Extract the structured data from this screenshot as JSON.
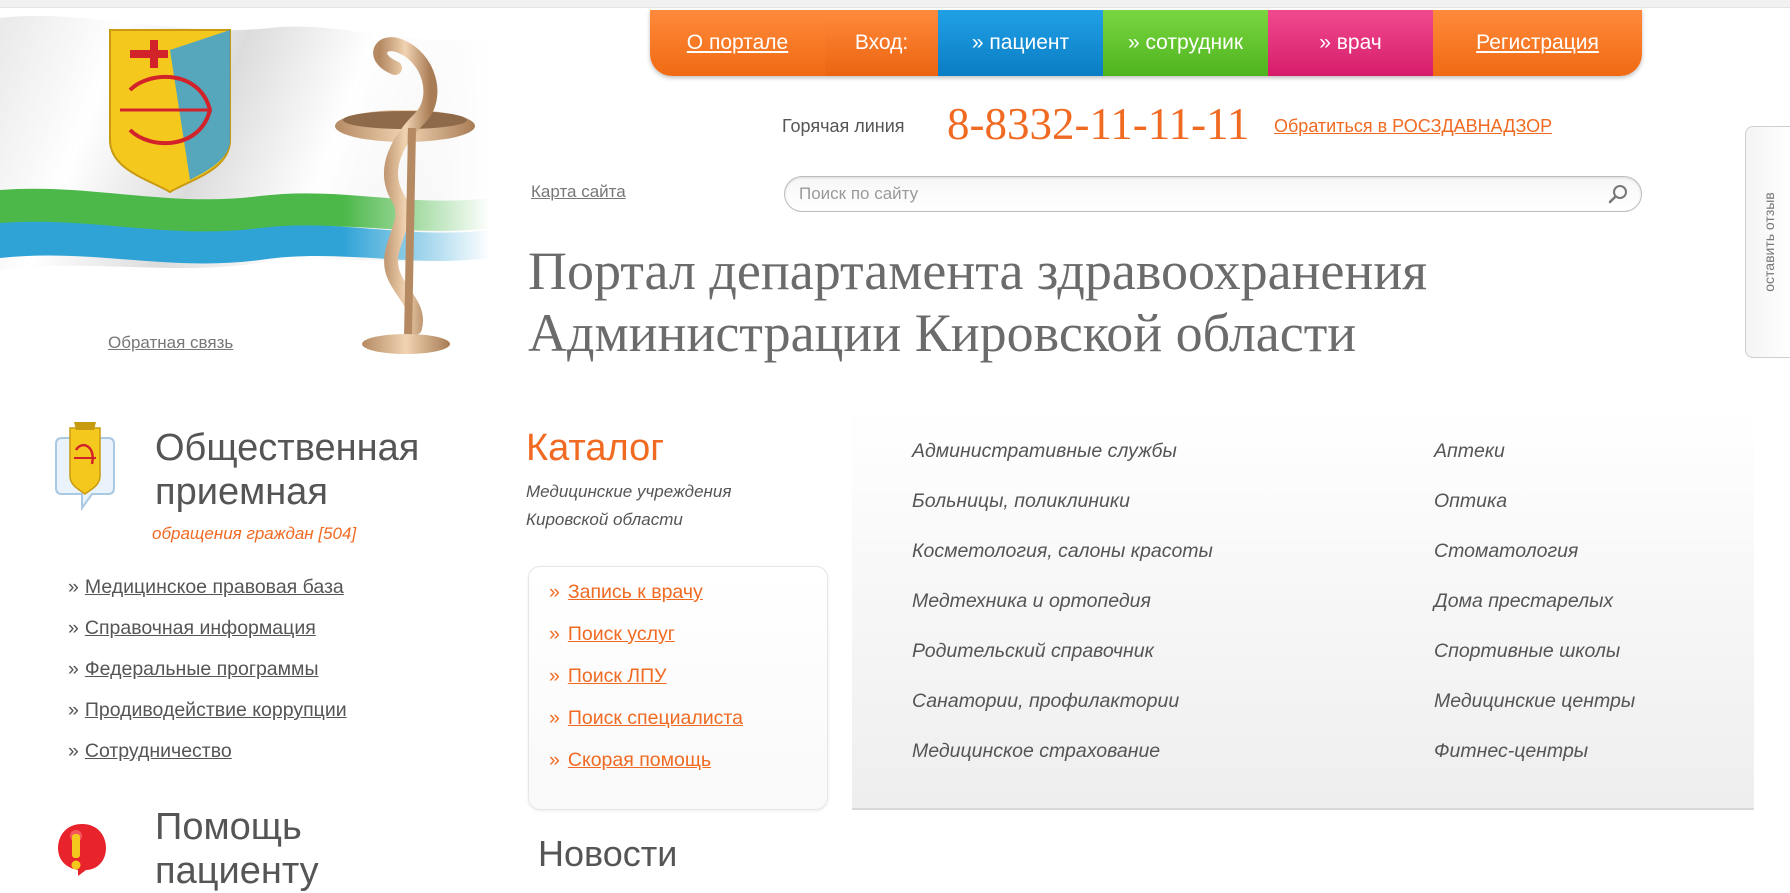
{
  "nav": {
    "about": "О портале",
    "login": "Вход:",
    "patient": "» пациент",
    "staff": "» сотрудник",
    "doctor": "» врач",
    "register": "Регистрация"
  },
  "hotline": {
    "label": "Горячая линия",
    "number": "8-8332-11-11-11"
  },
  "roszdrav_link": "Обратиться в РОСЗДАВНАДЗОР",
  "sitemap_link": "Карта сайта",
  "search": {
    "placeholder": "Поиск по сайту"
  },
  "site_title": "Портал департамента здравоохранения Администрации Кировской области",
  "feedback_link": "Обратная связь",
  "side_tab": "оставить отзыв",
  "reception": {
    "title": "Общественная приемная",
    "subtitle": "обращения граждан [504]"
  },
  "left_links": [
    "Медицинское правовая база",
    "Справочная информация",
    "Федеральные программы",
    "Продиводействие коррупции",
    "Сотрудничество"
  ],
  "link_marker": "»",
  "help": {
    "title": "Помощь пациенту"
  },
  "catalog": {
    "title": "Каталог",
    "subtitle": "Медицинские учреждения Кировской области",
    "quick_links": [
      "Запись к врачу",
      "Поиск услуг",
      "Поиск ЛПУ",
      "Поиск специалиста",
      "Скорая помощь"
    ],
    "categories_col1": [
      "Административные службы",
      "Больницы, поликлиники",
      "Косметология, салоны красоты",
      "Медтехника и ортопедия",
      "Родительский справочник",
      "Санатории, профилактории",
      "Медицинское страхование"
    ],
    "categories_col2": [
      "Аптеки",
      "Оптика",
      "Стоматология",
      "Дома престарелых",
      "Спортивные школы",
      "Медицинские центры",
      "Фитнес-центры"
    ]
  },
  "news": {
    "title": "Новости"
  },
  "colors": {
    "accent_orange": "#f06a22",
    "nav_blue": "#0a7dc4",
    "nav_green": "#4eb41e",
    "nav_pink": "#d61d6b",
    "text_gray": "#555555"
  }
}
